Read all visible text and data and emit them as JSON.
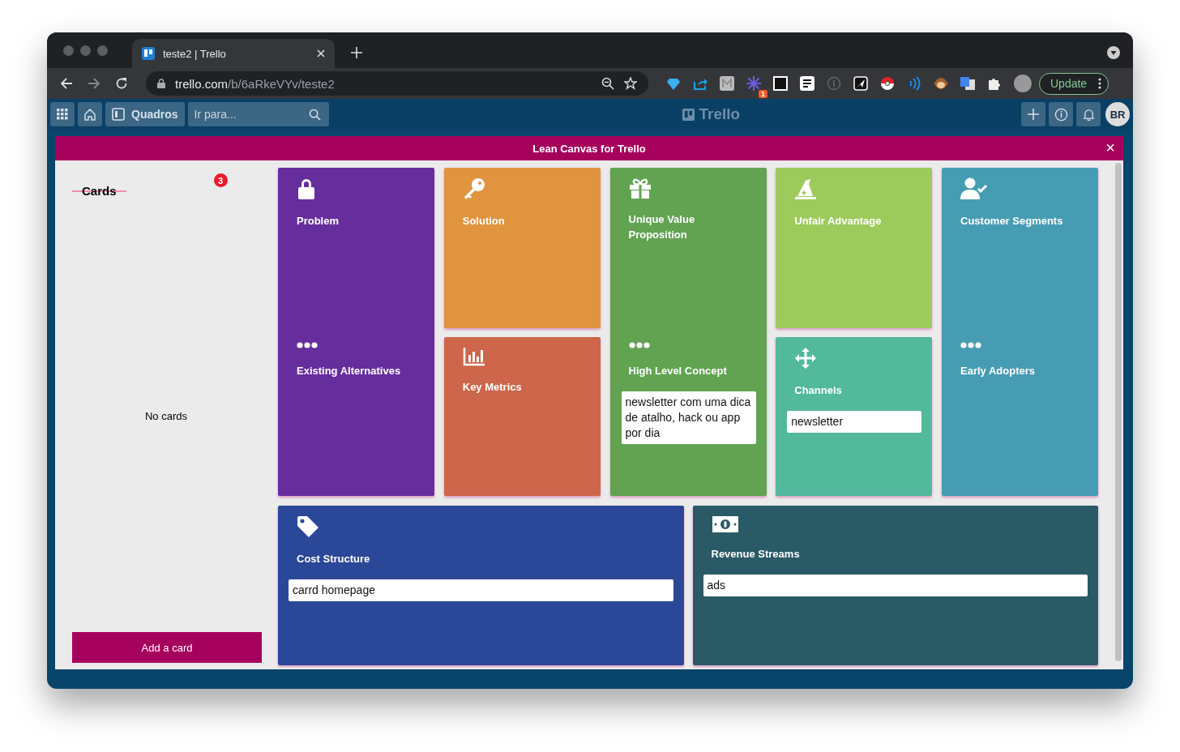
{
  "browser": {
    "tab_title": "teste2 | Trello",
    "url_host": "trello.com",
    "url_path": "/b/6aRkeVYv/teste2",
    "extension_badge": "1",
    "update_button": "Update"
  },
  "trello_header": {
    "boards_button": "Quadros",
    "search": {
      "placeholder": "Ir para..."
    },
    "logo": "Trello",
    "avatar": "BR"
  },
  "modal": {
    "title": "Lean Canvas for Trello",
    "close": "×"
  },
  "cards_panel": {
    "title": "Cards",
    "badge": "3",
    "empty": "No cards",
    "add_button": "Add a card"
  },
  "columns": [
    {
      "kind": "merged",
      "color": "#662d9c",
      "sections": [
        {
          "kind": "lock",
          "title": "Problem"
        },
        {
          "kind": "dots",
          "title": "Existing Alternatives"
        }
      ]
    },
    {
      "kind": "split",
      "sections": [
        {
          "kind": "key",
          "title": "Solution",
          "color": "#e0943e"
        },
        {
          "kind": "chart",
          "title": "Key Metrics",
          "color": "#cd664a"
        }
      ]
    },
    {
      "kind": "merged",
      "color": "#62a352",
      "sections": [
        {
          "kind": "gift",
          "title": "Unique Value Proposition"
        },
        {
          "kind": "dots",
          "title": "High Level Concept",
          "cards": [
            "newsletter com uma dica de atalho, hack ou app por dia"
          ]
        }
      ]
    },
    {
      "kind": "split",
      "sections": [
        {
          "kind": "hat",
          "title": "Unfair Advantage",
          "color": "#9ccb5c"
        },
        {
          "kind": "arrows",
          "title": "Channels",
          "color": "#52b99b",
          "cards": [
            "newsletter"
          ]
        }
      ]
    },
    {
      "kind": "merged",
      "color": "#469db3",
      "sections": [
        {
          "kind": "user",
          "title": "Customer Segments"
        },
        {
          "kind": "dots",
          "title": "Early Adopters"
        }
      ]
    }
  ],
  "bottom_blocks": [
    {
      "kind": "tag",
      "title": "Cost Structure",
      "color": "#2b4898",
      "cards": [
        "carrd homepage"
      ]
    },
    {
      "kind": "money",
      "title": "Revenue Streams",
      "color": "#295a66",
      "cards": [
        "ads"
      ]
    }
  ]
}
